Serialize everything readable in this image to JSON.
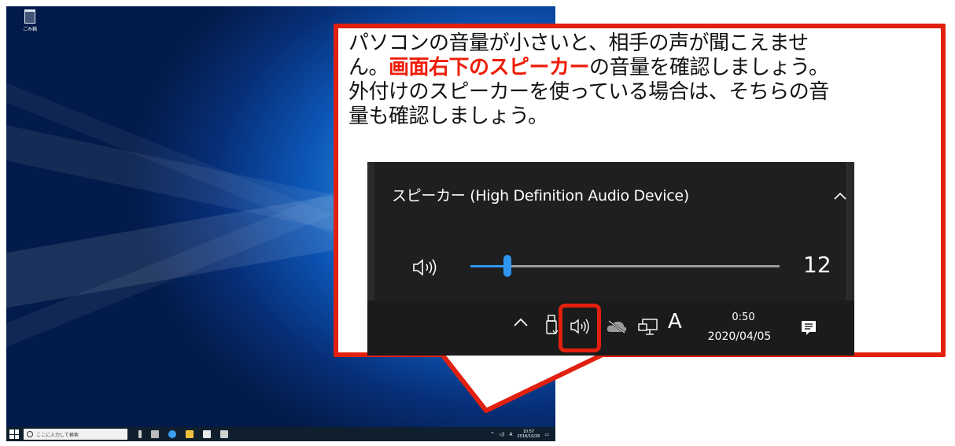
{
  "desktop": {
    "recycle_bin_label": "ごみ箱",
    "taskbar": {
      "search_placeholder": "ここに入力して検索",
      "ime_indicator": "A",
      "time": "10:57",
      "date": "2018/10/26"
    }
  },
  "callout": {
    "line1": "パソコンの音量が小さいと、相手の声が聞こえませ",
    "line2_prefix": "ん。",
    "line2_highlight": "画面右下のスピーカー",
    "line2_suffix": "の音量を確認しましょう。",
    "line3": "外付けのスピーカーを使っている場合は、そちらの音",
    "line4": "量も確認しましょう。",
    "highlight_color": "#ee1d0a",
    "border_color": "#e2200f"
  },
  "volume_flyout": {
    "device_name": "スピーカー (High Definition Audio Device)",
    "volume_value": "12",
    "volume_level": 0.12,
    "accent_color": "#2f96f0"
  },
  "tray": {
    "ime_indicator": "A",
    "time": "0:50",
    "date": "2020/04/05",
    "icons": [
      "chevron-up-icon",
      "usb-icon",
      "speaker-icon",
      "onedrive-icon",
      "network-icon",
      "action-center-icon"
    ]
  }
}
